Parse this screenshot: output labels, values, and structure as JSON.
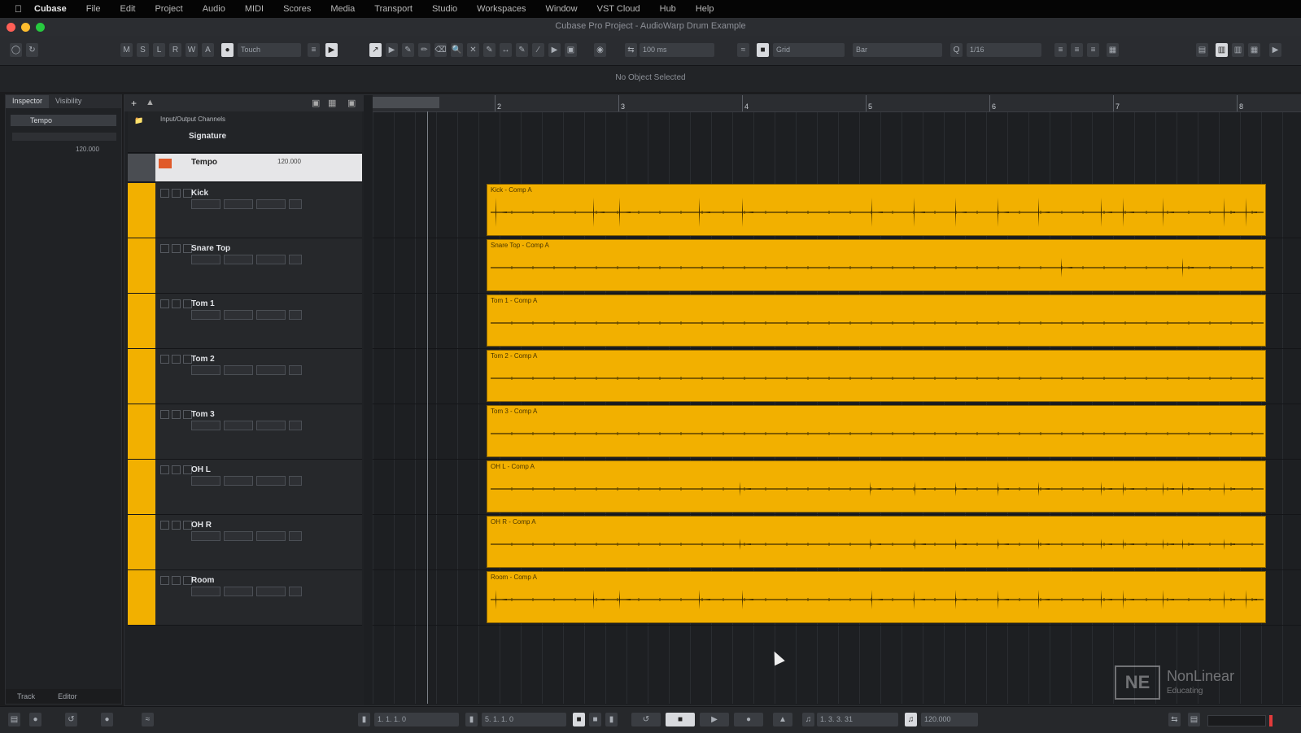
{
  "menubar": {
    "apple": "",
    "app": "Cubase",
    "items": [
      "File",
      "Edit",
      "Project",
      "Audio",
      "MIDI",
      "Scores",
      "Media",
      "Transport",
      "Studio",
      "Workspaces",
      "Window",
      "VST Cloud",
      "Hub",
      "Help"
    ]
  },
  "window": {
    "title": "Cubase Pro Project - AudioWarp Drum Example"
  },
  "toolbar": {
    "automation_mode": "Touch",
    "nudge": "100 ms",
    "snap_type": "Grid",
    "grid_type": "Bar",
    "quantize": "1/16"
  },
  "infoline": {
    "text": "No Object Selected"
  },
  "inspector": {
    "tabs": [
      "Inspector",
      "Visibility"
    ],
    "tempo_label": "Tempo",
    "tempo_value": "120.000",
    "bottom_tabs": [
      "Track",
      "Editor"
    ]
  },
  "folder": {
    "label": "Input/Output Channels"
  },
  "signature_track": {
    "label": "Signature"
  },
  "tempo_track": {
    "label": "Tempo",
    "value": "120.000"
  },
  "ruler": {
    "bars": [
      "2",
      "3",
      "4",
      "5",
      "6",
      "7",
      "8"
    ]
  },
  "tracks": [
    {
      "name": "Kick",
      "event": "Kick - Comp A"
    },
    {
      "name": "Snare Top",
      "event": "Snare Top - Comp A"
    },
    {
      "name": "Tom 1",
      "event": "Tom 1 - Comp A"
    },
    {
      "name": "Tom 2",
      "event": "Tom 2 - Comp A"
    },
    {
      "name": "Tom 3",
      "event": "Tom 3 - Comp A"
    },
    {
      "name": "OH L",
      "event": "OH L - Comp A"
    },
    {
      "name": "OH R",
      "event": "OH R - Comp A"
    },
    {
      "name": "Room",
      "event": "Room - Comp A"
    }
  ],
  "transport": {
    "left_locator": "1. 1. 1. 0",
    "right_locator": "5. 1. 1. 0",
    "position": "1. 3. 3. 31",
    "tempo": "120.000"
  },
  "watermark": {
    "brand": "NonLinear",
    "sub": "Educating"
  },
  "colors": {
    "event": "#f2b000",
    "accent": "#f2b000"
  }
}
